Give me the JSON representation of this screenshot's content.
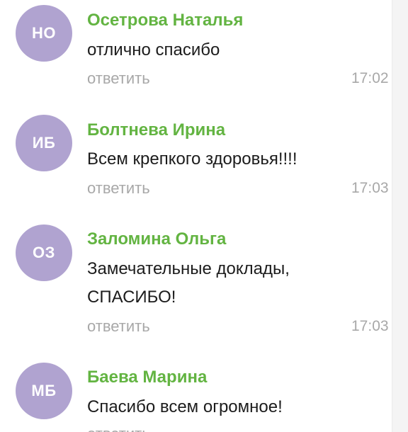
{
  "messages": [
    {
      "initials": "НО",
      "author": "Осетрова Наталья",
      "lines": [
        "отлично спасибо"
      ],
      "reply_label": "ответить",
      "time": "17:02"
    },
    {
      "initials": "ИБ",
      "author": "Болтнева Ирина",
      "lines": [
        "Всем крепкого здоровья!!!!"
      ],
      "reply_label": "ответить",
      "time": "17:03"
    },
    {
      "initials": "ОЗ",
      "author": "Заломина Ольга",
      "lines": [
        "Замечательные доклады,",
        "СПАСИБО!"
      ],
      "reply_label": "ответить",
      "time": "17:03"
    },
    {
      "initials": "МБ",
      "author": "Баева Марина",
      "lines": [
        "Спасибо всем огромное!"
      ],
      "reply_label": "ответить",
      "time": ""
    }
  ],
  "colors": {
    "avatar": "#b0a3d0",
    "author": "#63b442",
    "meta": "#a8a8a8"
  }
}
